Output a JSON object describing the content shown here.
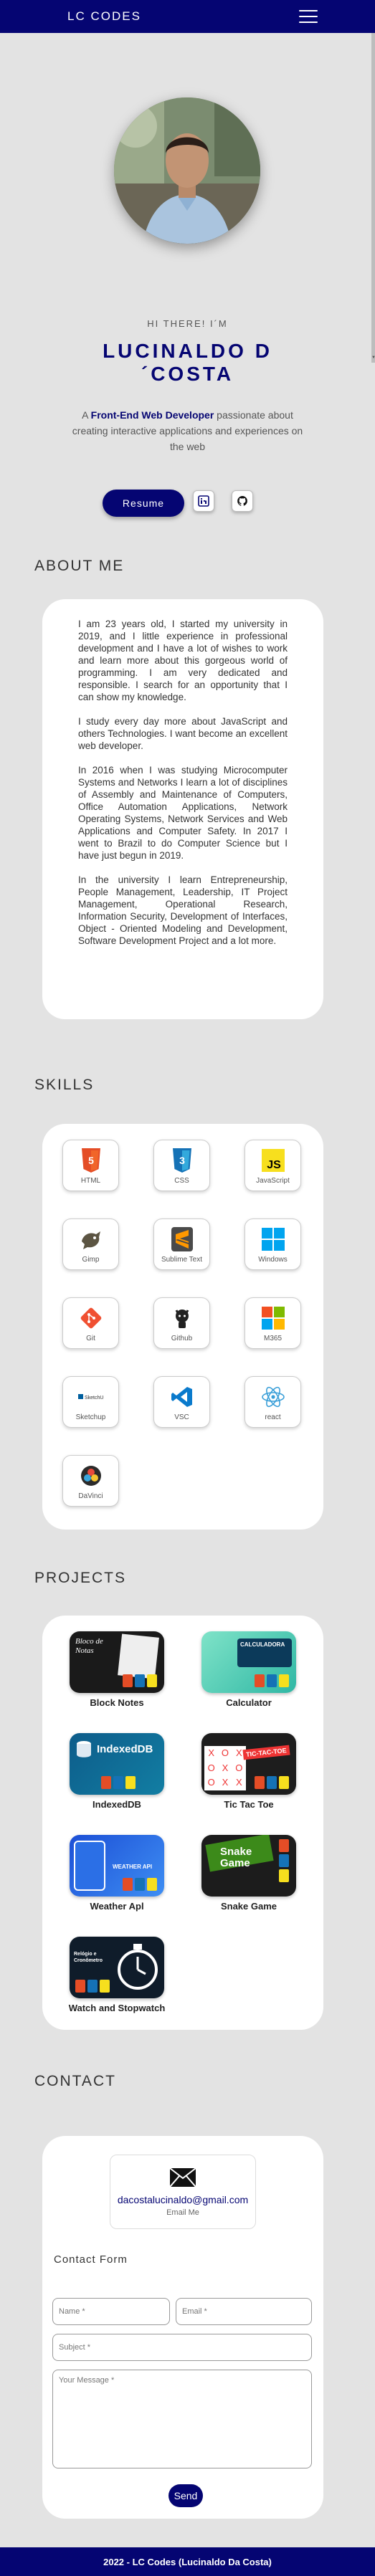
{
  "nav": {
    "brand": "LC CODES"
  },
  "hero": {
    "greeting": "HI THERE! I´M",
    "name_line1": "LUCINALDO D",
    "name_line2": "´COSTA",
    "tagline_prefix": "A ",
    "tagline_role": "Front-End Web Developer",
    "tagline_suffix": " passionate about creating interactive applications and experiences on the web",
    "resume_label": "Resume"
  },
  "about": {
    "title": "ABOUT ME",
    "paragraphs": [
      "I am 23 years old, I started my university in 2019, and I little experience in professional development and I have a lot of wishes to work and learn more about this gorgeous world of programming. I am very dedicated and responsible. I search for an opportunity that I can show my knowledge.",
      "I study every day more about JavaScript and others Technologies. I want become an excellent web developer.",
      "In 2016 when I was studying Microcomputer Systems and Networks I learn a lot of disciplines of Assembly and Maintenance of Computers, Office Automation Applications, Network Operating Systems, Network Services and Web Applications and Computer Safety. In 2017 I went to Brazil to do Computer Science but I have just begun in 2019.",
      "In the university I learn Entrepreneurship, People Management, Leadership, IT Project Management, Operational Research, Information Security, Development of Interfaces, Object - Oriented Modeling and Development, Software Development Project and a lot more."
    ]
  },
  "skills": {
    "title": "SKILLS",
    "items": [
      {
        "label": "HTML",
        "icon": "html5-icon"
      },
      {
        "label": "CSS",
        "icon": "css3-icon"
      },
      {
        "label": "JavaScript",
        "icon": "javascript-icon"
      },
      {
        "label": "Gimp",
        "icon": "gimp-icon"
      },
      {
        "label": "Sublime Text",
        "icon": "sublime-text-icon"
      },
      {
        "label": "Windows",
        "icon": "windows-icon"
      },
      {
        "label": "Git",
        "icon": "git-icon"
      },
      {
        "label": "Github",
        "icon": "github-icon"
      },
      {
        "label": "M365",
        "icon": "microsoft-365-icon"
      },
      {
        "label": "Sketchup",
        "icon": "sketchup-icon"
      },
      {
        "label": "VSC",
        "icon": "vscode-icon"
      },
      {
        "label": "react",
        "icon": "react-icon"
      },
      {
        "label": "DaVinci",
        "icon": "davinci-resolve-icon"
      }
    ]
  },
  "projects": {
    "title": "PROJECTS",
    "items": [
      {
        "label": "Block Notes",
        "thumb_text": "Bloco de Notas"
      },
      {
        "label": "Calculator",
        "thumb_text": "CALCULADORA"
      },
      {
        "label": "IndexedDB",
        "thumb_text": "IndexedDB"
      },
      {
        "label": "Tic Tac Toe",
        "thumb_text": "TIC-TAC-TOE"
      },
      {
        "label": "Weather Apl",
        "thumb_text": "WEATHER API"
      },
      {
        "label": "Snake Game",
        "thumb_text": "Snake Game"
      },
      {
        "label": "Watch and Stopwatch",
        "thumb_text": "Relógio e Cronômetro"
      }
    ]
  },
  "contact": {
    "title": "CONTACT",
    "email": "dacostalucinaldo@gmail.com",
    "email_caption": "Email Me",
    "form_title": "Contact Form",
    "name_placeholder": "Name *",
    "email_placeholder": "Email *",
    "subject_placeholder": "Subject *",
    "message_placeholder": "Your Message *",
    "send_label": "Send"
  },
  "footer": {
    "text": "2022 - LC Codes (Lucinaldo Da Costa)"
  },
  "colors": {
    "primary": "#050572",
    "background": "#e3e3e3",
    "card": "#ffffff"
  }
}
